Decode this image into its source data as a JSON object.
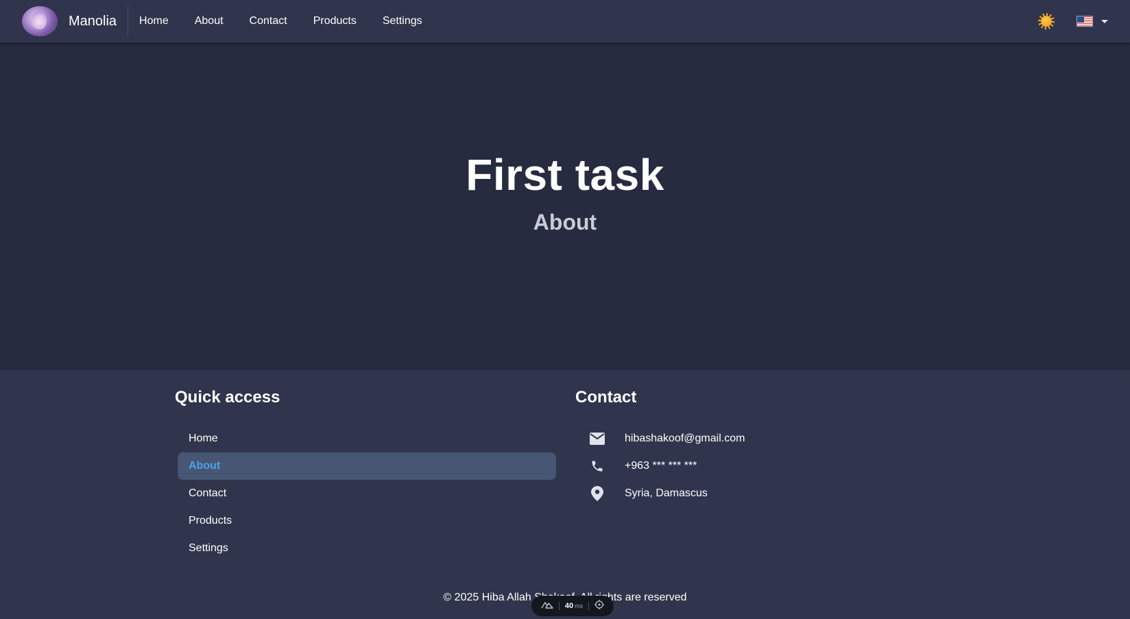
{
  "navbar": {
    "brand_name": "Manolia",
    "links": [
      "Home",
      "About",
      "Contact",
      "Products",
      "Settings"
    ],
    "theme_icon": "sun-icon",
    "language_icon": "us-flag-icon"
  },
  "hero": {
    "title": "First task",
    "subtitle": "About"
  },
  "footer": {
    "quick_access": {
      "title": "Quick access",
      "items": [
        "Home",
        "About",
        "Contact",
        "Products",
        "Settings"
      ],
      "active_item": "About"
    },
    "contact": {
      "title": "Contact",
      "email": "hibashakoof@gmail.com",
      "phone": "+963 *** *** ***",
      "location": "Syria, Damascus"
    },
    "copyright": "© 2025 Hiba Allah Shakoof. All rights are reserved"
  },
  "devtools": {
    "render_time": "40",
    "render_unit": "ms"
  },
  "colors": {
    "page_bg": "#262b40",
    "nav_bg": "#30354d",
    "active_item_bg": "#475672",
    "accent": "#4aa3ef"
  }
}
